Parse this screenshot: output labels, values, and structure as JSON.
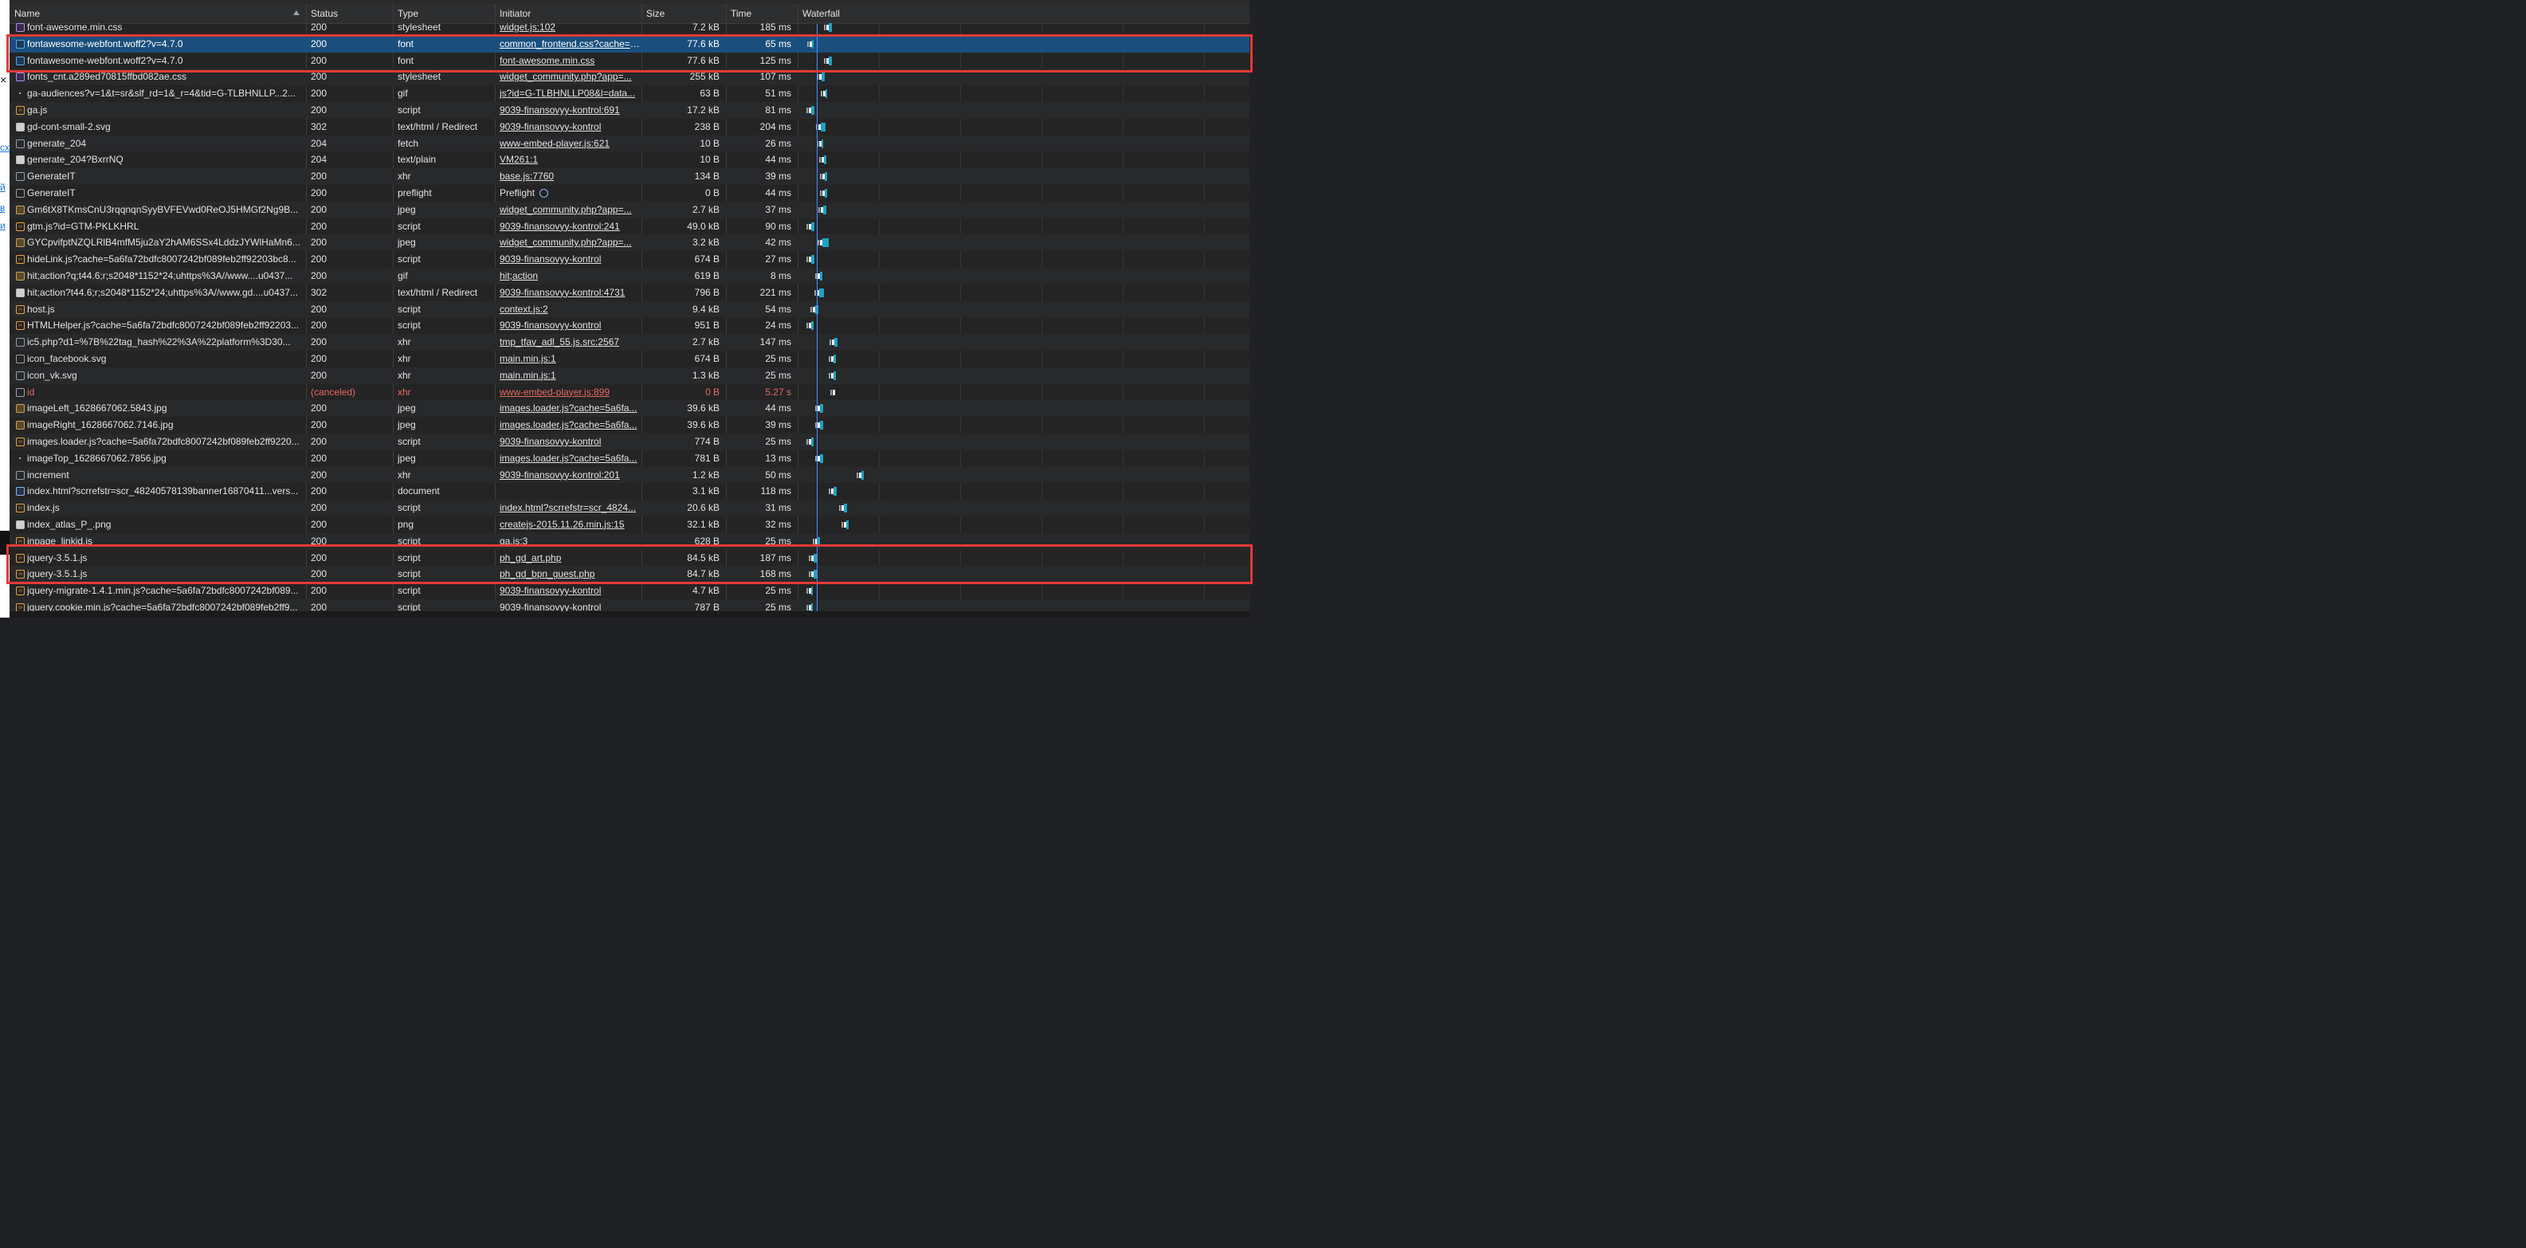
{
  "colors": {
    "panel_bg": "#242424",
    "selected_row": "#1a4f7d",
    "error_text": "#e46962",
    "highlight_box": "#e53935",
    "timeline_marker": "#4c8df6",
    "waterfall_bar": "#1aa3c7"
  },
  "header": {
    "name": "Name",
    "status": "Status",
    "type": "Type",
    "initiator": "Initiator",
    "size": "Size",
    "time": "Time",
    "waterfall": "Waterfall"
  },
  "requests": [
    {
      "icon": "css-icon",
      "name": "font-awesome.min.css",
      "status": "200",
      "type": "stylesheet",
      "initiator": "widget.js:102",
      "size": "7.2 kB",
      "time": "185 ms"
    },
    {
      "icon": "font-icon",
      "name": "fontawesome-webfont.woff2?v=4.7.0",
      "status": "200",
      "type": "font",
      "initiator": "common_frontend.css?cache=5a6fa72bdfc",
      "size": "77.6 kB",
      "time": "65 ms",
      "selected": true
    },
    {
      "icon": "font-icon",
      "name": "fontawesome-webfont.woff2?v=4.7.0",
      "status": "200",
      "type": "font",
      "initiator": "font-awesome.min.css",
      "size": "77.6 kB",
      "time": "125 ms"
    },
    {
      "icon": "css-icon",
      "name": "fonts_cnt.a289ed70815ffbd082ae.css",
      "status": "200",
      "type": "stylesheet",
      "initiator": "widget_community.php?app=...",
      "size": "255 kB",
      "time": "107 ms"
    },
    {
      "icon": "dot-icon",
      "name": "ga-audiences?v=1&t=sr&slf_rd=1&_r=4&tid=G-TLBHNLLP...2...",
      "status": "200",
      "type": "gif",
      "initiator": "js?id=G-TLBHNLLP08&l=data...",
      "size": "63 B",
      "time": "51 ms"
    },
    {
      "icon": "script-icon",
      "name": "ga.js",
      "status": "200",
      "type": "script",
      "initiator": "9039-finansovyy-kontrol:691",
      "size": "17.2 kB",
      "time": "81 ms"
    },
    {
      "icon": "svg-icon",
      "name": "gd-cont-small-2.svg",
      "status": "302",
      "type": "text/html / Redirect",
      "initiator": "9039-finansovyy-kontrol",
      "size": "238 B",
      "time": "204 ms"
    },
    {
      "icon": "blank-icon",
      "name": "generate_204",
      "status": "204",
      "type": "fetch",
      "initiator": "www-embed-player.js:621",
      "size": "10 B",
      "time": "26 ms"
    },
    {
      "icon": "svg-icon",
      "name": "generate_204?BxrrNQ",
      "status": "204",
      "type": "text/plain",
      "initiator": "VM261:1",
      "size": "10 B",
      "time": "44 ms"
    },
    {
      "icon": "blank-icon",
      "name": "GenerateIT",
      "status": "200",
      "type": "xhr",
      "initiator": "base.js:7760",
      "size": "134 B",
      "time": "39 ms"
    },
    {
      "icon": "blank-icon",
      "name": "GenerateIT",
      "status": "200",
      "type": "preflight",
      "initiator": "Preflight",
      "size": "0 B",
      "time": "44 ms",
      "preflight": true
    },
    {
      "icon": "image-icon",
      "name": "Gm6tX8TKmsCnU3rqqnqnSyyBVFEVwd0ReOJ5HMGf2Ng9B...",
      "status": "200",
      "type": "jpeg",
      "initiator": "widget_community.php?app=...",
      "size": "2.7 kB",
      "time": "37 ms"
    },
    {
      "icon": "script-icon",
      "name": "gtm.js?id=GTM-PKLKHRL",
      "status": "200",
      "type": "script",
      "initiator": "9039-finansovyy-kontrol:241",
      "size": "49.0 kB",
      "time": "90 ms"
    },
    {
      "icon": "image-icon",
      "name": "GYCpvifptNZQLRlB4mfM5ju2aY2hAM6SSx4LddzJYWlHaMn6...",
      "status": "200",
      "type": "jpeg",
      "initiator": "widget_community.php?app=...",
      "size": "3.2 kB",
      "time": "42 ms"
    },
    {
      "icon": "script-icon",
      "name": "hideLink.js?cache=5a6fa72bdfc8007242bf089feb2ff92203bc8...",
      "status": "200",
      "type": "script",
      "initiator": "9039-finansovyy-kontrol",
      "size": "674 B",
      "time": "27 ms"
    },
    {
      "icon": "image-icon",
      "name": "hit;action?q;t44.6;r;s2048*1152*24;uhttps%3A//www....u0437...",
      "status": "200",
      "type": "gif",
      "initiator": "hit;action",
      "size": "619 B",
      "time": "8 ms"
    },
    {
      "icon": "svg-icon",
      "name": "hit;action?t44.6;r;s2048*1152*24;uhttps%3A//www.gd....u0437...",
      "status": "302",
      "type": "text/html / Redirect",
      "initiator": "9039-finansovyy-kontrol:4731",
      "size": "796 B",
      "time": "221 ms"
    },
    {
      "icon": "script-icon",
      "name": "host.js",
      "status": "200",
      "type": "script",
      "initiator": "context.js:2",
      "size": "9.4 kB",
      "time": "54 ms"
    },
    {
      "icon": "script-icon",
      "name": "HTMLHelper.js?cache=5a6fa72bdfc8007242bf089feb2ff92203...",
      "status": "200",
      "type": "script",
      "initiator": "9039-finansovyy-kontrol",
      "size": "951 B",
      "time": "24 ms"
    },
    {
      "icon": "blank-icon",
      "name": "ic5.php?d1=%7B%22tag_hash%22%3A%22platform%3D30...",
      "status": "200",
      "type": "xhr",
      "initiator": "tmp_tfav_adl_55.js.src:2567",
      "size": "2.7 kB",
      "time": "147 ms"
    },
    {
      "icon": "blank-icon",
      "name": "icon_facebook.svg",
      "status": "200",
      "type": "xhr",
      "initiator": "main.min.js:1",
      "size": "674 B",
      "time": "25 ms"
    },
    {
      "icon": "blank-icon",
      "name": "icon_vk.svg",
      "status": "200",
      "type": "xhr",
      "initiator": "main.min.js:1",
      "size": "1.3 kB",
      "time": "25 ms"
    },
    {
      "icon": "blank-icon",
      "name": "id",
      "status": "(canceled)",
      "type": "xhr",
      "initiator": "www-embed-player.js:899",
      "size": "0 B",
      "time": "5.27 s",
      "error": true
    },
    {
      "icon": "image-icon",
      "name": "imageLeft_1628667062.5843.jpg",
      "status": "200",
      "type": "jpeg",
      "initiator": "images.loader.js?cache=5a6fa...",
      "size": "39.6 kB",
      "time": "44 ms"
    },
    {
      "icon": "image-icon",
      "name": "imageRight_1628667062.7146.jpg",
      "status": "200",
      "type": "jpeg",
      "initiator": "images.loader.js?cache=5a6fa...",
      "size": "39.6 kB",
      "time": "39 ms"
    },
    {
      "icon": "script-icon",
      "name": "images.loader.js?cache=5a6fa72bdfc8007242bf089feb2ff9220...",
      "status": "200",
      "type": "script",
      "initiator": "9039-finansovyy-kontrol",
      "size": "774 B",
      "time": "25 ms"
    },
    {
      "icon": "dot-icon",
      "name": "imageTop_1628667062.7856.jpg",
      "status": "200",
      "type": "jpeg",
      "initiator": "images.loader.js?cache=5a6fa...",
      "size": "781 B",
      "time": "13 ms"
    },
    {
      "icon": "blank-icon",
      "name": "increment",
      "status": "200",
      "type": "xhr",
      "initiator": "9039-finansovyy-kontrol:201",
      "size": "1.2 kB",
      "time": "50 ms"
    },
    {
      "icon": "document-icon",
      "name": "index.html?scrrefstr=scr_48240578139banner16870411...vers...",
      "status": "200",
      "type": "document",
      "initiator": "",
      "size": "3.1 kB",
      "time": "118 ms"
    },
    {
      "icon": "script-icon",
      "name": "index.js",
      "status": "200",
      "type": "script",
      "initiator": "index.html?scrrefstr=scr_4824...",
      "size": "20.6 kB",
      "time": "31 ms"
    },
    {
      "icon": "svg-icon",
      "name": "index_atlas_P_.png",
      "status": "200",
      "type": "png",
      "initiator": "createjs-2015.11.26.min.js:15",
      "size": "32.1 kB",
      "time": "32 ms"
    },
    {
      "icon": "script-icon",
      "name": "inpage_linkid.js",
      "status": "200",
      "type": "script",
      "initiator": "ga.js:3",
      "size": "628 B",
      "time": "25 ms"
    },
    {
      "icon": "script-icon",
      "name": "jquery-3.5.1.js",
      "status": "200",
      "type": "script",
      "initiator": "ph_gd_art.php",
      "size": "84.5 kB",
      "time": "187 ms"
    },
    {
      "icon": "script-icon",
      "name": "jquery-3.5.1.js",
      "status": "200",
      "type": "script",
      "initiator": "ph_gd_bpn_guest.php",
      "size": "84.7 kB",
      "time": "168 ms"
    },
    {
      "icon": "script-icon",
      "name": "jquery-migrate-1.4.1.min.js?cache=5a6fa72bdfc8007242bf089...",
      "status": "200",
      "type": "script",
      "initiator": "9039-finansovyy-kontrol",
      "size": "4.7 kB",
      "time": "25 ms"
    },
    {
      "icon": "script-icon",
      "name": "jquery.cookie.min.js?cache=5a6fa72bdfc8007242bf089feb2ff9...",
      "status": "200",
      "type": "script",
      "initiator": "9039-finansovyy-kontrol",
      "size": "787 B",
      "time": "25 ms"
    }
  ]
}
